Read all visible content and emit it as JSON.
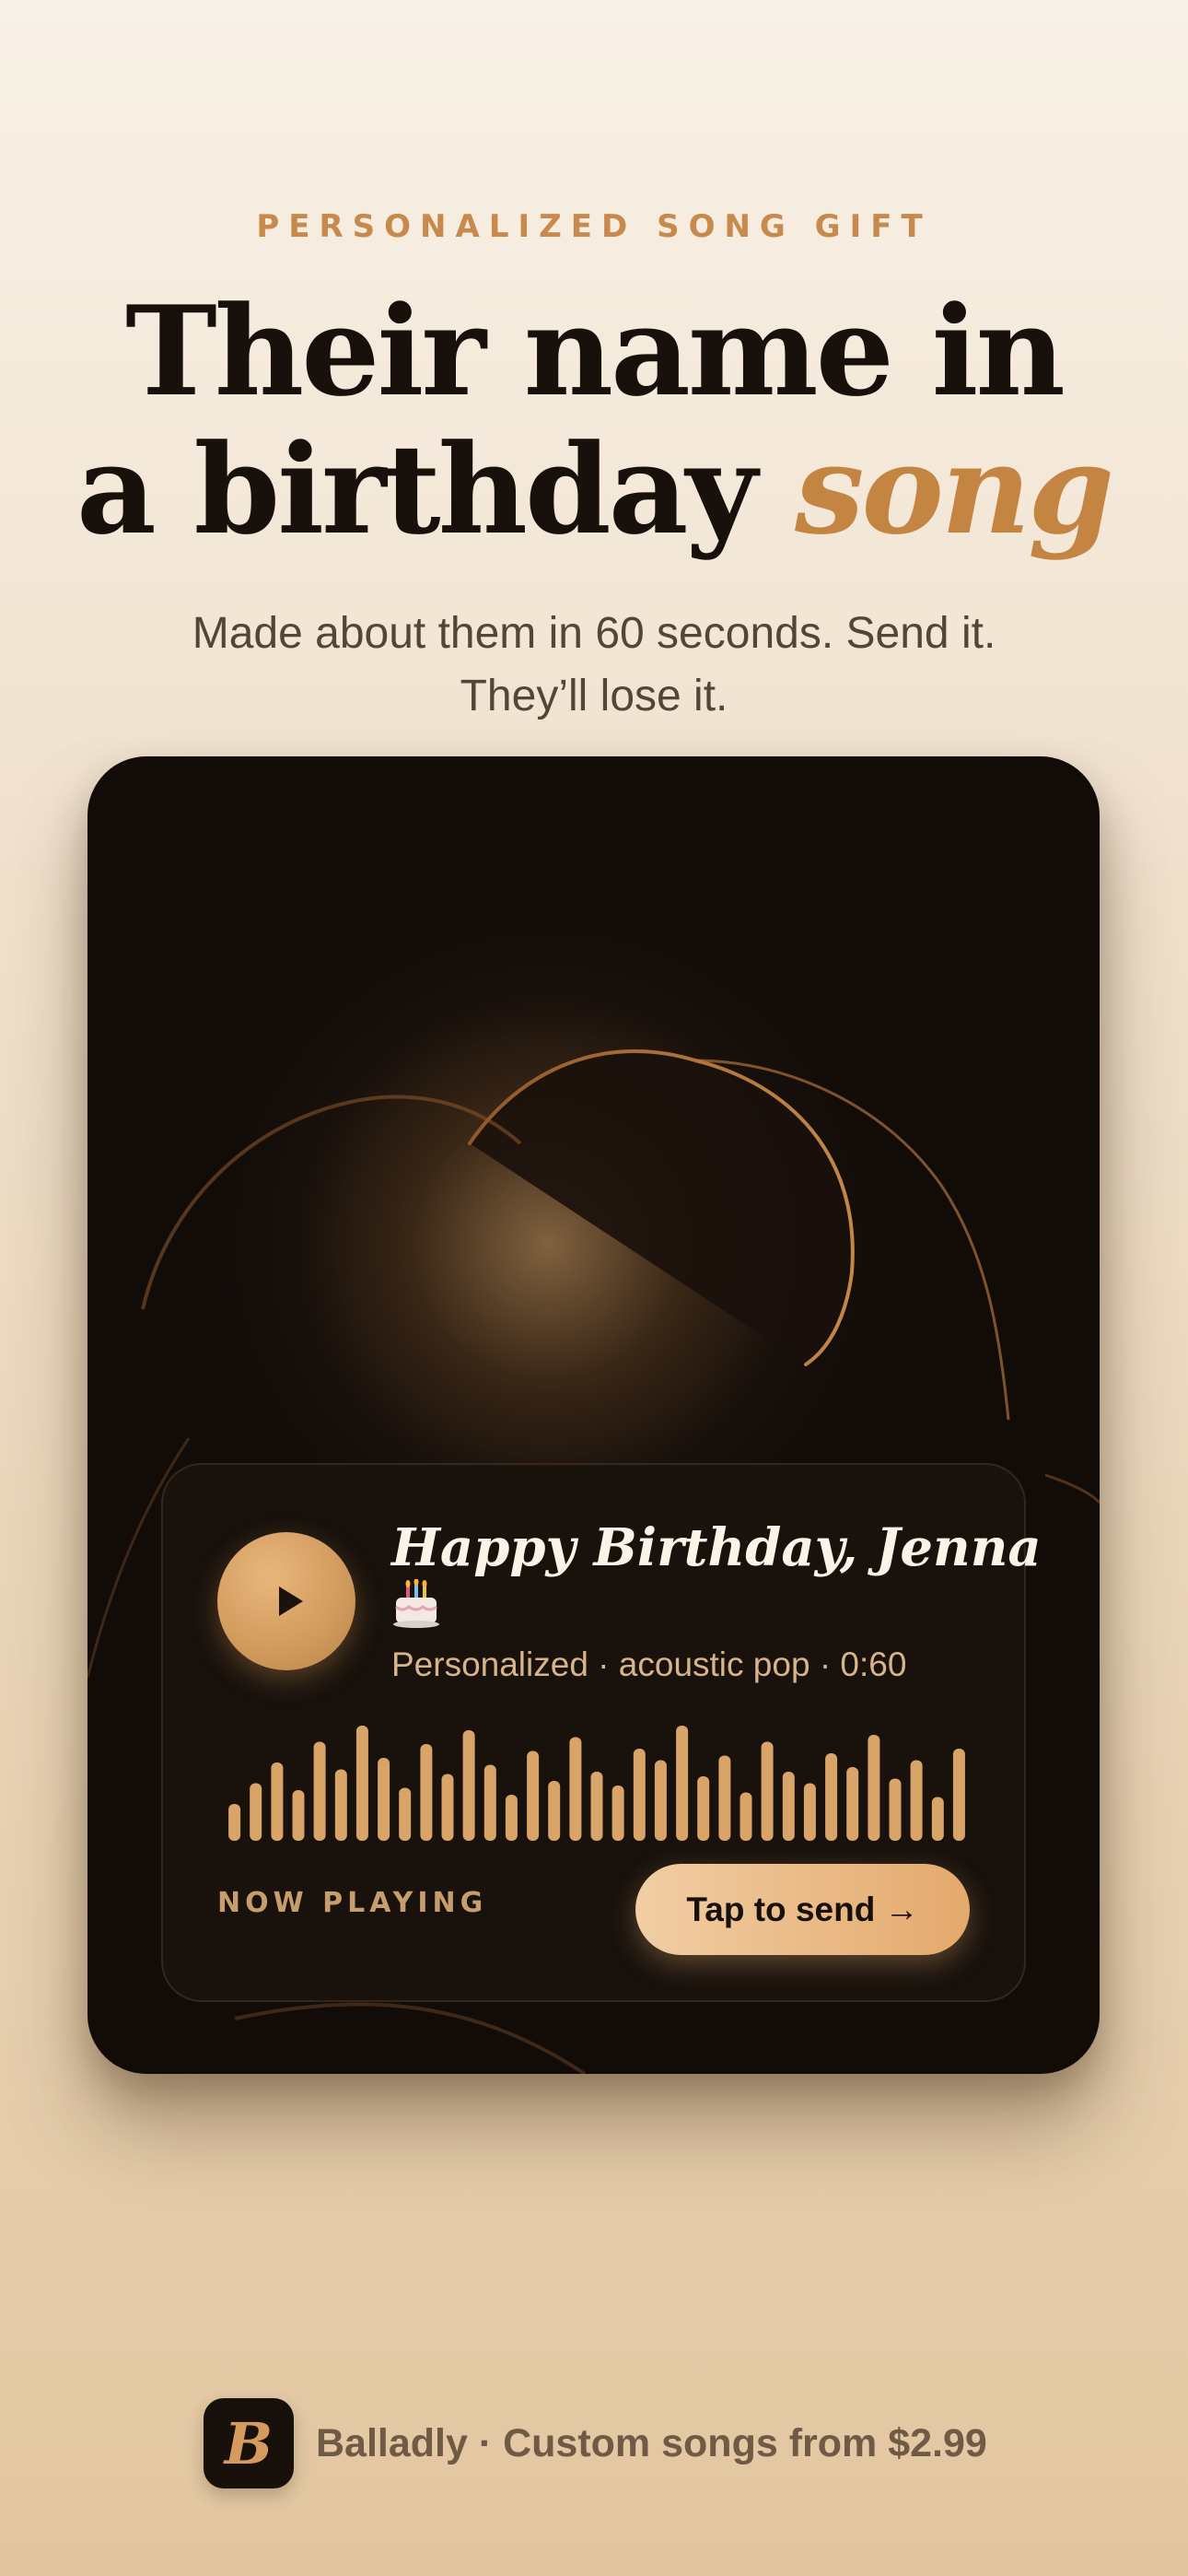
{
  "header": {
    "eyebrow": "PERSONALIZED SONG GIFT",
    "headline_line1": "Their name in",
    "headline_line2_plain": "a birthday",
    "headline_line2_accent": "song",
    "subhead_line1": "Made about them in 60 seconds. Send it.",
    "subhead_line2": "They’ll lose it."
  },
  "player": {
    "title": "Happy Birthday, Jenna",
    "title_icon": "birthday-cake-icon",
    "meta": "Personalized · acoustic pop · 0:60",
    "status_label": "NOW PLAYING",
    "send_label": "Tap to send →",
    "waveform_levels": [
      0.32,
      0.5,
      0.68,
      0.44,
      0.86,
      0.62,
      1.0,
      0.72,
      0.46,
      0.84,
      0.58,
      0.96,
      0.66,
      0.4,
      0.78,
      0.52,
      0.9,
      0.6,
      0.48,
      0.8,
      0.7,
      1.0,
      0.56,
      0.74,
      0.42,
      0.86,
      0.6,
      0.5,
      0.76,
      0.64,
      0.92,
      0.54,
      0.7,
      0.38,
      0.8
    ]
  },
  "footer": {
    "logo_letter": "B",
    "text": "Balladly · Custom songs from $2.99"
  },
  "colors": {
    "accent": "#c48543",
    "card_bg": "#120c09",
    "waveform": "#d9a468"
  }
}
